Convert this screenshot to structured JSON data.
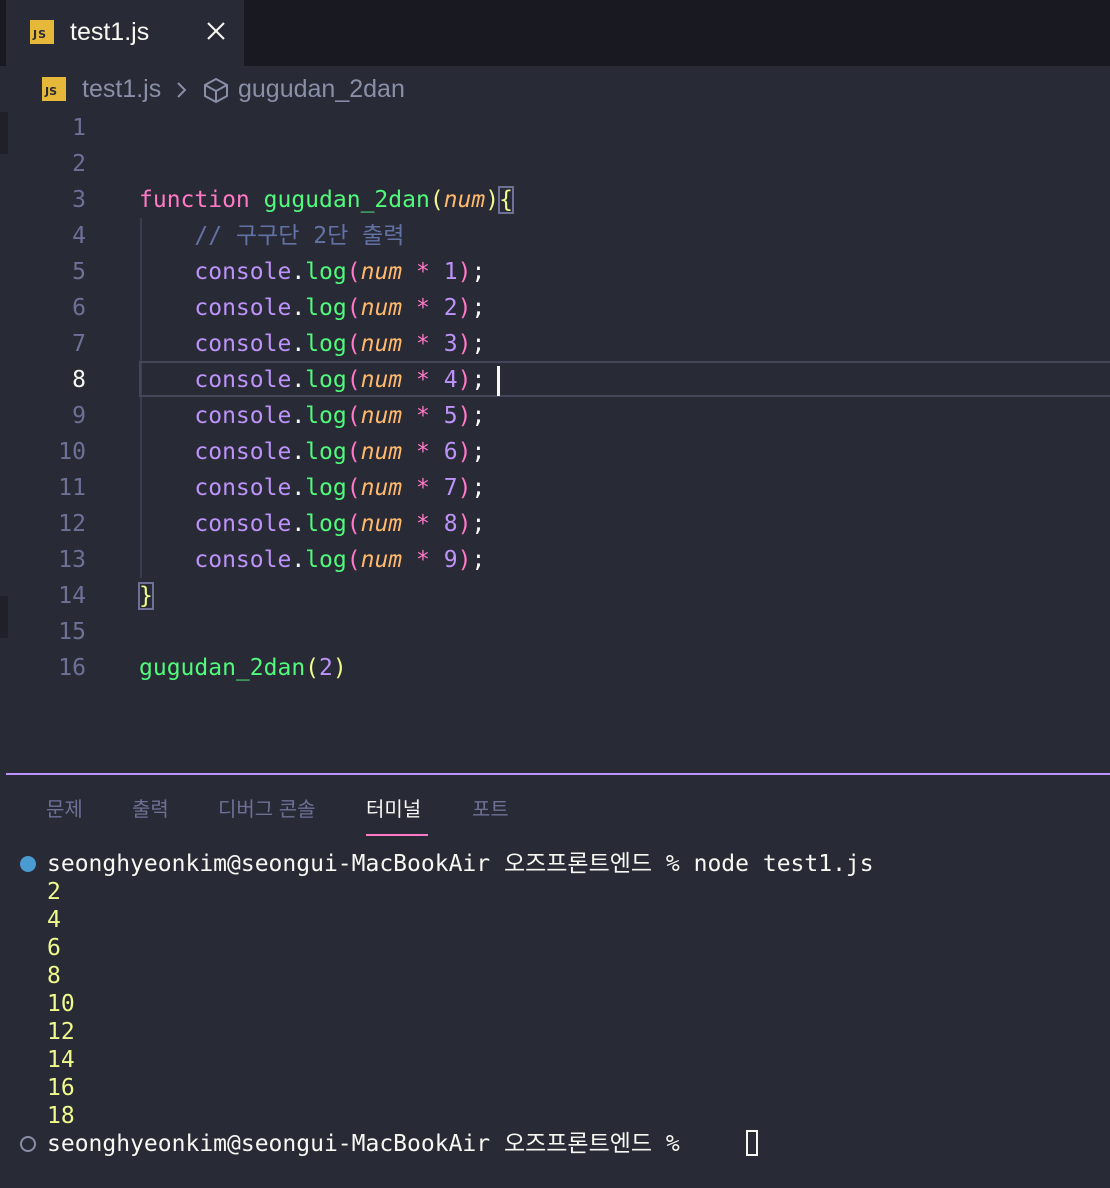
{
  "tab": {
    "label": "test1.js",
    "icon": "js-file-icon",
    "close_icon": "close-icon"
  },
  "breadcrumb": {
    "file": "test1.js",
    "symbol": "gugudan_2dan"
  },
  "editor": {
    "lines": [
      {
        "number": "1"
      },
      {
        "number": "2"
      },
      {
        "number": "3",
        "tokens": [
          "function",
          " ",
          "gugudan_2dan",
          "(",
          "num",
          ")",
          "{"
        ]
      },
      {
        "number": "4",
        "text": "    // 구구단 2단 출력"
      },
      {
        "number": "5",
        "mult": "1"
      },
      {
        "number": "6",
        "mult": "2"
      },
      {
        "number": "7",
        "mult": "3"
      },
      {
        "number": "8",
        "mult": "4"
      },
      {
        "number": "9",
        "mult": "5"
      },
      {
        "number": "10",
        "mult": "6"
      },
      {
        "number": "11",
        "mult": "7"
      },
      {
        "number": "12",
        "mult": "8"
      },
      {
        "number": "13",
        "mult": "9"
      },
      {
        "number": "14",
        "text": "}"
      },
      {
        "number": "15"
      },
      {
        "number": "16",
        "call": "gugudan_2dan",
        "arg": "2"
      }
    ],
    "active_line": "8"
  },
  "panel": {
    "tabs": [
      "문제",
      "출력",
      "디버그 콘솔",
      "터미널",
      "포트"
    ],
    "active_tab": "터미널"
  },
  "terminal": {
    "prompt1": "seonghyeonkim@seongui-MacBookAir 오즈프론트엔드 % node test1.js",
    "outputs": [
      "2",
      "4",
      "6",
      "8",
      "10",
      "12",
      "14",
      "16",
      "18"
    ],
    "prompt2": "seonghyeonkim@seongui-MacBookAir 오즈프론트엔드 % "
  },
  "colors": {
    "background": "#282a36",
    "keyword": "#ff79c6",
    "function": "#50fa7b",
    "parameter": "#ffb86c",
    "number": "#bd93f9",
    "comment": "#6272a4",
    "terminal_output": "#f1fa8c",
    "panel_accent": "#bd93f9"
  }
}
